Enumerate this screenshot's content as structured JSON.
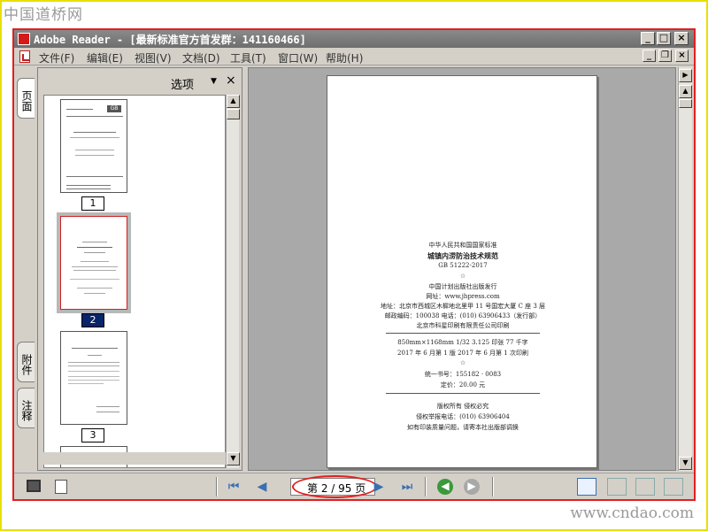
{
  "watermark": {
    "top": "中国道桥网",
    "bottom": "www.cndao.com"
  },
  "window": {
    "title": "Adobe Reader - [最新标准官方首发群：141160466]"
  },
  "menu": [
    "文件(F)",
    "编辑(E)",
    "视图(V)",
    "文档(D)",
    "工具(T)",
    "窗口(W)",
    "帮助(H)"
  ],
  "tabs": {
    "pages": "页面",
    "attachments": "附件",
    "comments": "注释"
  },
  "panel": {
    "options_label": "选项",
    "close": "×"
  },
  "thumbnails": [
    {
      "number": "1",
      "selected": false
    },
    {
      "number": "2",
      "selected": true
    },
    {
      "number": "3",
      "selected": false
    }
  ],
  "document_page": {
    "lines": [
      "中华人民共和国国家标准",
      "城镇内涝防治技术规范",
      "GB 51222-2017",
      "☆",
      "中国计划出版社出版发行",
      "网址：www.jhpress.com",
      "地址：北京市西城区木樨地北里甲 11 号国宏大厦 C 座 3 层",
      "邮政编码：100038   电话：(010) 63906433（发行部）",
      "北京市科星印刷有限责任公司印刷",
      "850mm×1168mm   1/32   3.125 印张   77 千字",
      "2017 年 6 月第 1 版   2017 年 6 月第 1 次印刷",
      "☆",
      "统一书号：155182 · 0083",
      "定价：20.00 元",
      "版权所有   侵权必究",
      "侵权举报电话：(010) 63906404",
      "如有印装质量问题，请寄本社出版部调换"
    ]
  },
  "navigation": {
    "current_page_text": "第 2 / 95 页",
    "first": "⏮",
    "prev": "◀",
    "next": "▶",
    "last": "⏭"
  },
  "colors": {
    "accent_red": "#e02020",
    "watermark_frame": "#e8e000",
    "selection": "#0a246a"
  }
}
